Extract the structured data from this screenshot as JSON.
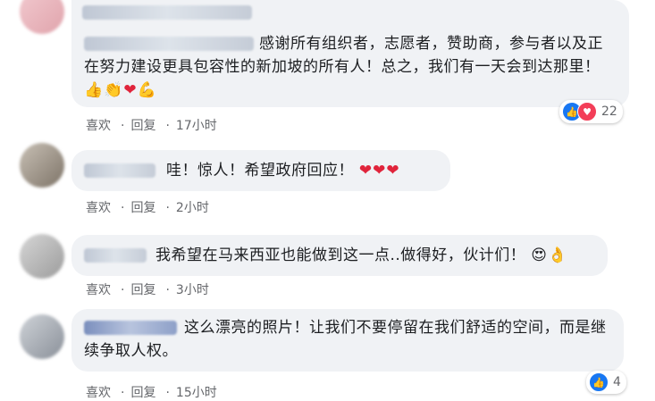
{
  "comments": [
    {
      "text": "感谢所有组织者，志愿者，赞助商，参与者以及正在努力建设更具包容性的新加坡的所有人！总之，我们有一天会到达那里！",
      "emojis": [
        "👍",
        "👏",
        "❤",
        "💪"
      ],
      "like_label": "喜欢",
      "reply_label": "回复",
      "time": "17小时",
      "reaction_count": "22"
    },
    {
      "text": "哇！惊人！希望政府回应！",
      "emojis": [
        "❤",
        "❤",
        "❤"
      ],
      "like_label": "喜欢",
      "reply_label": "回复",
      "time": "2小时"
    },
    {
      "text": "我希望在马来西亚也能做到这一点..做得好，伙计们！",
      "emojis": [
        "😍",
        "👌"
      ],
      "like_label": "喜欢",
      "reply_label": "回复",
      "time": "3小时"
    },
    {
      "text": "这么漂亮的照片！让我们不要停留在我们舒适的空间，而是继续争取人权。",
      "like_label": "喜欢",
      "reply_label": "回复",
      "time": "15小时",
      "reaction_count": "4"
    }
  ],
  "icons": {
    "like": "like-icon",
    "love": "love-icon"
  },
  "colors": {
    "bubble": "#f0f2f5",
    "meta_text": "#65676b",
    "like_blue": "#1877f2",
    "love_red": "#f33e58"
  }
}
